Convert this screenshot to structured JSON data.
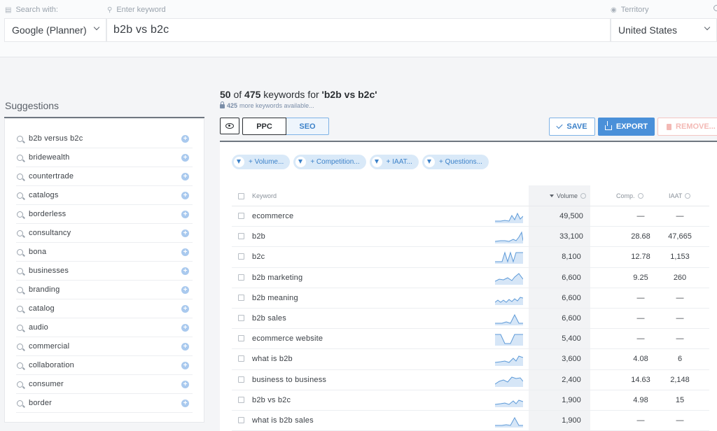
{
  "search": {
    "engine_label": "Search with:",
    "engine_value": "Google (Planner)",
    "keyword_label": "Enter keyword",
    "keyword_value": "b2b vs b2c",
    "territory_label": "Territory",
    "territory_value": "United States"
  },
  "suggestions": {
    "title": "Suggestions",
    "items": [
      "b2b versus b2c",
      "bridewealth",
      "countertrade",
      "catalogs",
      "borderless",
      "consultancy",
      "bona",
      "businesses",
      "branding",
      "catalog",
      "audio",
      "commercial",
      "collaboration",
      "consumer",
      "border"
    ]
  },
  "results": {
    "shown": "50",
    "of_text": "of",
    "total": "475",
    "for_text": "keywords for",
    "query": "'b2b vs b2c'",
    "more_count": "425",
    "more_text": "more keywords available..."
  },
  "toolbar": {
    "ppc_label": "PPC",
    "seo_label": "SEO",
    "save_label": "SAVE",
    "export_label": "EXPORT",
    "remove_label": "REMOVE..."
  },
  "filters": [
    "+ Volume...",
    "+ Competition...",
    "+ IAAT...",
    "+ Questions..."
  ],
  "table": {
    "headers": {
      "keyword": "Keyword",
      "volume": "Volume",
      "comp": "Comp.",
      "iaat": "IAAT"
    },
    "rows": [
      {
        "keyword": "ecommerce",
        "volume": "49,500",
        "comp": "—",
        "iaat": "—"
      },
      {
        "keyword": "b2b",
        "volume": "33,100",
        "comp": "28.68",
        "iaat": "47,665"
      },
      {
        "keyword": "b2c",
        "volume": "8,100",
        "comp": "12.78",
        "iaat": "1,153"
      },
      {
        "keyword": "b2b marketing",
        "volume": "6,600",
        "comp": "9.25",
        "iaat": "260"
      },
      {
        "keyword": "b2b meaning",
        "volume": "6,600",
        "comp": "—",
        "iaat": "—"
      },
      {
        "keyword": "b2b sales",
        "volume": "6,600",
        "comp": "—",
        "iaat": "—"
      },
      {
        "keyword": "ecommerce website",
        "volume": "5,400",
        "comp": "—",
        "iaat": "—"
      },
      {
        "keyword": "what is b2b",
        "volume": "3,600",
        "comp": "4.08",
        "iaat": "6"
      },
      {
        "keyword": "business to business",
        "volume": "2,400",
        "comp": "14.63",
        "iaat": "2,148"
      },
      {
        "keyword": "b2b vs b2c",
        "volume": "1,900",
        "comp": "4.98",
        "iaat": "15"
      },
      {
        "keyword": "what is b2b sales",
        "volume": "1,900",
        "comp": "—",
        "iaat": "—"
      }
    ]
  },
  "colors": {
    "accent": "#4a90d9",
    "chip_bg": "#d9e9f8",
    "remove": "#f3b9b5"
  },
  "icons": [
    "list-icon",
    "search-icon",
    "location-icon",
    "eye-icon",
    "check-icon",
    "export-icon",
    "trash-icon",
    "filter-icon",
    "info-icon",
    "plus-icon",
    "lock-icon",
    "sort-desc-icon"
  ]
}
